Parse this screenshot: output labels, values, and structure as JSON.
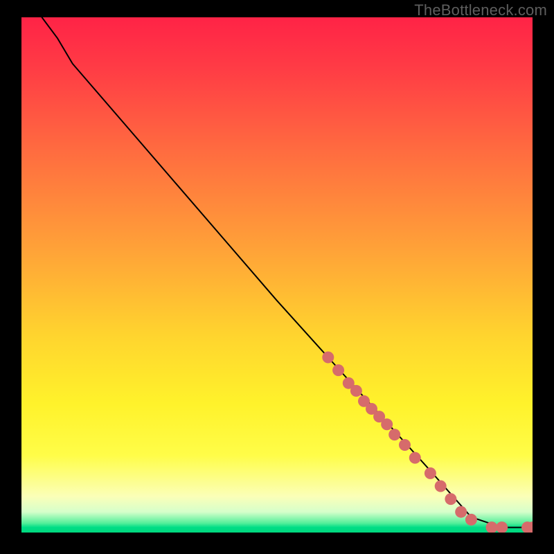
{
  "watermark": "TheBottleneck.com",
  "chart_data": {
    "type": "line",
    "title": "",
    "xlabel": "",
    "ylabel": "",
    "xlim": [
      0,
      100
    ],
    "ylim": [
      0,
      100
    ],
    "curve": {
      "name": "bottleneck-curve",
      "points_xy": [
        [
          4,
          100
        ],
        [
          7,
          96
        ],
        [
          10,
          91
        ],
        [
          20,
          79.5
        ],
        [
          30,
          68
        ],
        [
          40,
          56.5
        ],
        [
          50,
          45
        ],
        [
          60,
          34
        ],
        [
          70,
          23
        ],
        [
          80,
          12
        ],
        [
          88,
          3
        ],
        [
          94,
          1
        ],
        [
          97,
          1
        ],
        [
          100,
          1
        ]
      ]
    },
    "markers": {
      "name": "highlighted-segment",
      "color": "#d66b6b",
      "points_xy": [
        [
          60,
          34
        ],
        [
          62,
          31.5
        ],
        [
          64,
          29
        ],
        [
          65.5,
          27.5
        ],
        [
          67,
          25.5
        ],
        [
          68.5,
          24
        ],
        [
          70,
          22.5
        ],
        [
          71.5,
          21
        ],
        [
          73,
          19
        ],
        [
          75,
          17
        ],
        [
          77,
          14.5
        ],
        [
          80,
          11.5
        ],
        [
          82,
          9
        ],
        [
          84,
          6.5
        ],
        [
          86,
          4
        ],
        [
          88,
          2.5
        ],
        [
          92,
          1
        ],
        [
          94,
          1
        ],
        [
          99,
          1
        ],
        [
          100,
          1
        ]
      ]
    }
  }
}
